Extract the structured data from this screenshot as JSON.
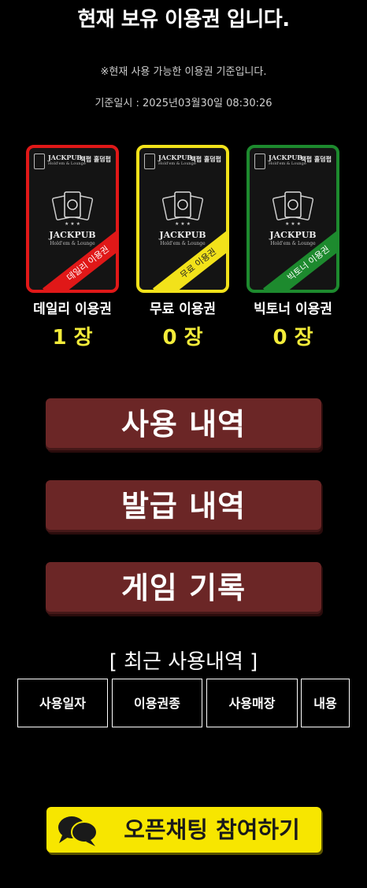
{
  "header": {
    "title": "현재 보유 이용권 입니다.",
    "note": "※현재 사용 가능한 이용권 기준입니다.",
    "timestamp": "기준일시 : 2025년03월30일 08:30:26"
  },
  "card_common": {
    "brand": "JACKPUB",
    "sub": "Hold'em & Lounge",
    "tag": "잭펍 홀덤펍"
  },
  "tickets": [
    {
      "name": "데일리 이용권",
      "count": "1 장",
      "ribbon": "데일리 이용권",
      "color": "#e01818"
    },
    {
      "name": "무료 이용권",
      "count": "0 장",
      "ribbon": "무료 이용권",
      "color": "#f2e21a"
    },
    {
      "name": "빅토너 이용권",
      "count": "0 장",
      "ribbon": "빅토너 이용권",
      "color": "#1d8a2e"
    }
  ],
  "buttons": {
    "usage_history": "사용 내역",
    "issue_history": "발급 내역",
    "game_record": "게임 기록"
  },
  "recent": {
    "heading": "[ 최근 사용내역 ]",
    "columns": [
      "사용일자",
      "이용권종",
      "사용매장",
      "내용"
    ]
  },
  "open_chat": {
    "label": "오픈채팅 참여하기",
    "icon": "chat-bubbles-icon"
  }
}
